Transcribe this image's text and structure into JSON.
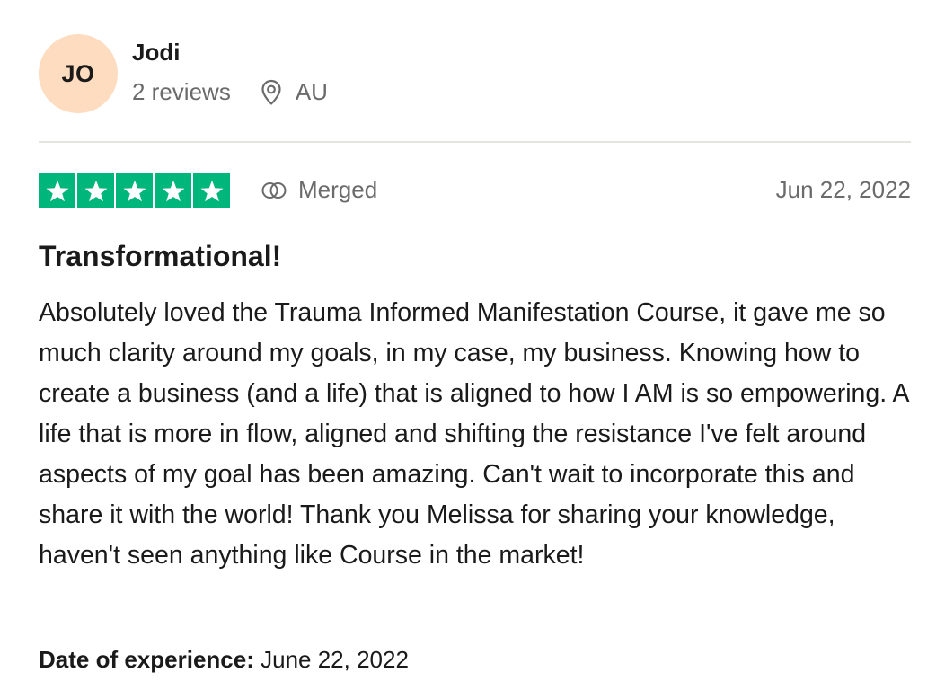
{
  "reviewer": {
    "initials": "JO",
    "name": "Jodi",
    "reviews_count": "2 reviews",
    "location": "AU",
    "avatar_color": "#fddcc0"
  },
  "review": {
    "rating": 5,
    "rating_max": 5,
    "star_color": "#00b67a",
    "merged_label": "Merged",
    "date": "Jun 22, 2022",
    "title": "Transformational!",
    "body": "Absolutely loved the Trauma Informed Manifestation Course, it gave me so much clarity around my goals, in my case, my business. Knowing how to create a business (and a life) that is aligned to how I AM is so empowering. A life that is more in flow, aligned and shifting the resistance I've felt around aspects of my goal has been amazing. Can't wait to incorporate this and share it with the world! Thank you Melissa for sharing your knowledge, haven't seen anything like Course in the market!",
    "experience_label": "Date of experience:",
    "experience_date": "June 22, 2022"
  },
  "icons": {
    "location": "location-pin-icon",
    "merged": "merged-rings-icon",
    "star": "star-icon"
  }
}
